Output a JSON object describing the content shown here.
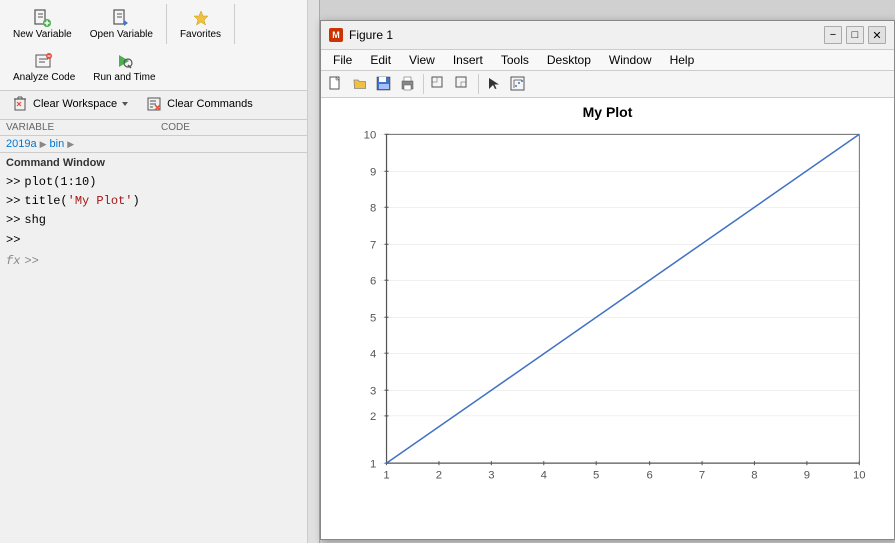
{
  "matlab": {
    "toolbar": {
      "new_variable_label": "New Variable",
      "open_variable_label": "Open Variable",
      "clear_workspace_label": "Clear Workspace",
      "analyze_code_label": "Analyze Code",
      "run_and_time_label": "Run and Time",
      "clear_commands_label": "Clear Commands",
      "favorites_label": "Favorites"
    },
    "section_labels": {
      "variable": "VARIABLE",
      "code": "CODE"
    },
    "breadcrumb": {
      "year": "2019a",
      "arrow": "▶",
      "folder": "bin",
      "arrow2": "▶"
    },
    "command_window": {
      "title": "Command Window",
      "lines": [
        {
          "prompt": ">>",
          "text": "plot(1:10)"
        },
        {
          "prompt": ">>",
          "text": "title('My Plot')"
        },
        {
          "prompt": ">>",
          "text": "shg"
        },
        {
          "prompt": ">>",
          "text": ""
        }
      ]
    },
    "fx_prompt": "fx >>"
  },
  "figure": {
    "title": "Figure 1",
    "title_icon": "M",
    "controls": {
      "minimize": "−",
      "maximize": "□",
      "close": "✕"
    },
    "menu": {
      "items": [
        "File",
        "Edit",
        "View",
        "Insert",
        "Tools",
        "Desktop",
        "Window",
        "Help"
      ]
    },
    "toolbar_icons": [
      "📁",
      "📂",
      "💾",
      "🖨",
      "⬚",
      "⬚",
      "⬚",
      "↖",
      "⬚"
    ],
    "plot": {
      "title": "My Plot",
      "x_min": 1,
      "x_max": 10,
      "y_min": 1,
      "y_max": 10,
      "x_ticks": [
        1,
        2,
        3,
        4,
        5,
        6,
        7,
        8,
        9,
        10
      ],
      "y_ticks": [
        1,
        2,
        3,
        4,
        5,
        6,
        7,
        8,
        9,
        10
      ],
      "line_color": "#4472c4"
    }
  },
  "colors": {
    "accent": "#0078d4",
    "toolbar_bg": "#f5f5f5",
    "panel_bg": "#f0f0f0"
  }
}
